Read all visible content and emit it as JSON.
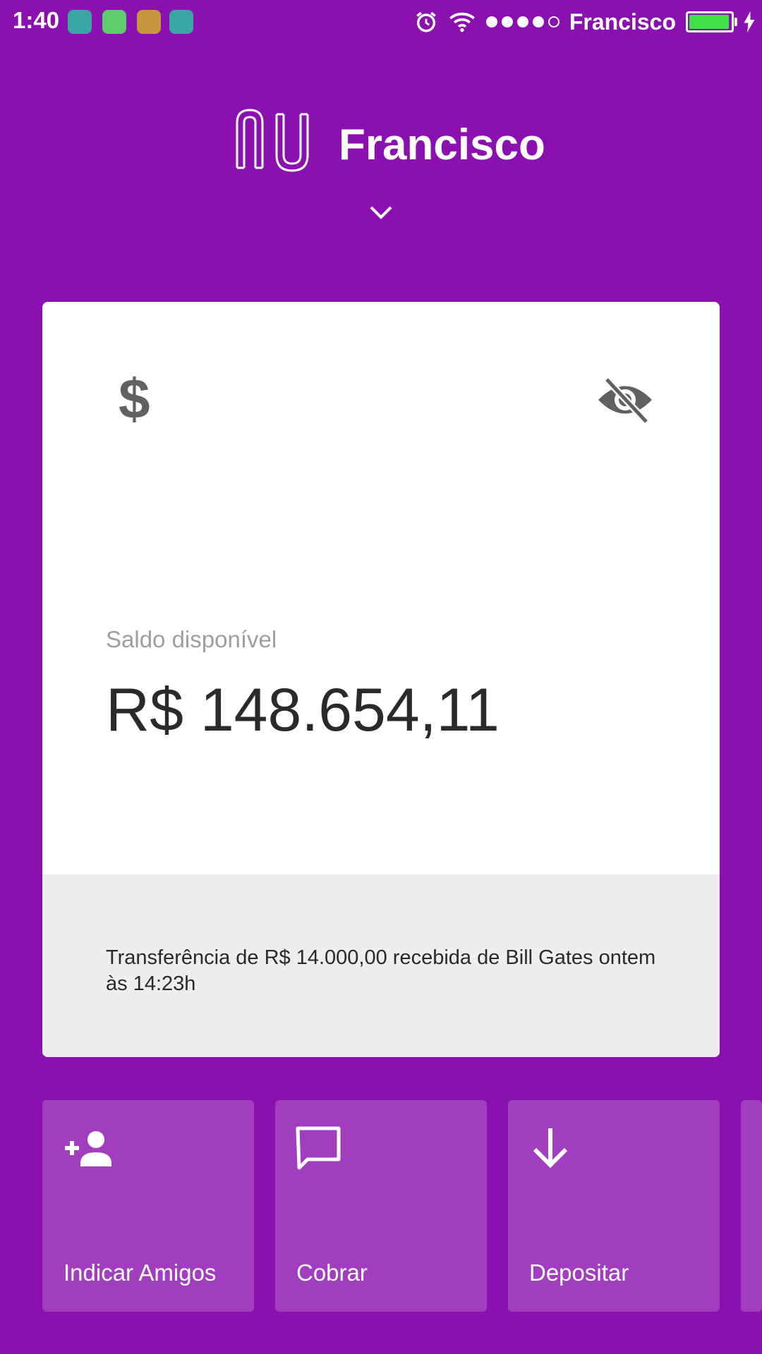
{
  "status_bar": {
    "time": "1:40",
    "carrier": "Francisco",
    "signal_dots": 5,
    "signal_filled": 4,
    "battery_level": 1.0,
    "colors": {
      "battery_fill": "#3ee044"
    }
  },
  "header": {
    "owner_name": "Francisco"
  },
  "card": {
    "balance_label": "Saldo disponível",
    "balance_amount": "R$ 148.654,11",
    "footer_text": "Transferência de R$ 14.000,00 recebida de Bill Gates ontem às 14:23h",
    "dollar_glyph": "$"
  },
  "actions": [
    {
      "label": "Indicar Amigos",
      "icon": "add-person-icon"
    },
    {
      "label": "Cobrar",
      "icon": "message-icon"
    },
    {
      "label": "Depositar",
      "icon": "arrow-down-icon"
    }
  ],
  "colors": {
    "background": "#8a10b0",
    "tile": "#a23dbf",
    "card": "#ffffff",
    "card_footer": "#eeeeee"
  }
}
